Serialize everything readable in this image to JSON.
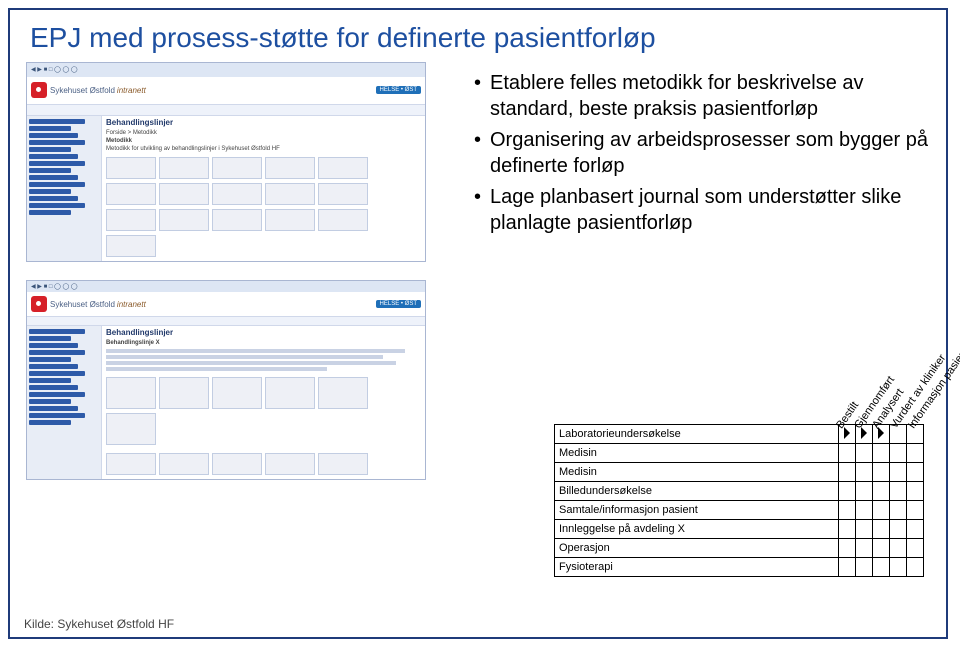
{
  "title": "EPJ med prosess-støtte for definerte pasientforløp",
  "bullets": {
    "b1": "Etablere felles metodikk for beskrivelse av standard, beste praksis pasientforløp",
    "b2": "Organisering av arbeidsprosesser som bygger på definerte forløp",
    "b3": "Lage planbasert journal som understøtter slike planlagte pasientforløp"
  },
  "thumb_common": {
    "org": "Sykehuset Østfold",
    "brand": "intranett",
    "badge": "HELSE • ØST"
  },
  "thumb1": {
    "main_title": "Behandlingslinjer",
    "sub1": "Forside > Metodikk",
    "sub2": "Metodikk",
    "sub3": "Metodikk for utvikling av behandlingslinjer i Sykehuset Østfold HF"
  },
  "thumb2": {
    "main_title": "Behandlingslinjer",
    "sub1": "Behandlingslinje X"
  },
  "columns": {
    "c1": "Bestilt",
    "c2": "Gjennomført",
    "c3": "Analysert",
    "c4": "Vurdert av kliniker",
    "c5": "Informasjon pasient"
  },
  "rows": {
    "r1": "Laboratorieundersøkelse",
    "r2": "Medisin",
    "r3": "Medisin",
    "r4": "Billedundersøkelse",
    "r5": "Samtale/informasjon pasient",
    "r6": "Innleggelse på avdeling X",
    "r7": "Operasjon",
    "r8": "Fysioterapi"
  },
  "source": "Kilde: Sykehuset Østfold HF"
}
